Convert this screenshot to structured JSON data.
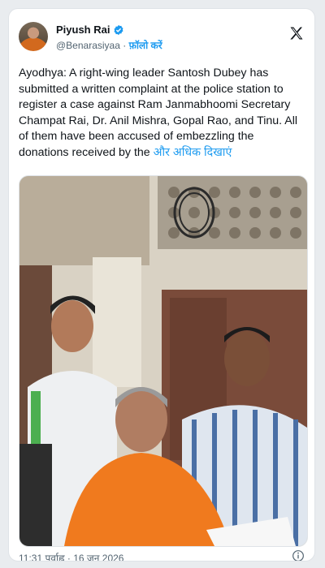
{
  "author": {
    "name": "Piyush Rai",
    "handle": "@Benarasiyaa",
    "separator": "·",
    "follow_label": "फ़ॉलो करें"
  },
  "tweet": {
    "text": "Ayodhya: A right-wing leader Santosh Dubey has submitted a written complaint at the police station to register a case against Ram Janmabhoomi Secretary Champat Rai, Dr. Anil Mishra, Gopal Rao, and Tinu. All of them have been accused of embezzling the donations received by the",
    "show_more": "और अधिक दिखाएं"
  },
  "footer": {
    "timestamp": "11:31 पूर्वाह्न · 16 जून 2026"
  },
  "icons": {
    "brand": "x-logo-icon",
    "verified": "verified-badge-icon",
    "info": "info-icon"
  },
  "colors": {
    "accent": "#1d9bf0",
    "text": "#0f1419",
    "muted": "#536471"
  }
}
